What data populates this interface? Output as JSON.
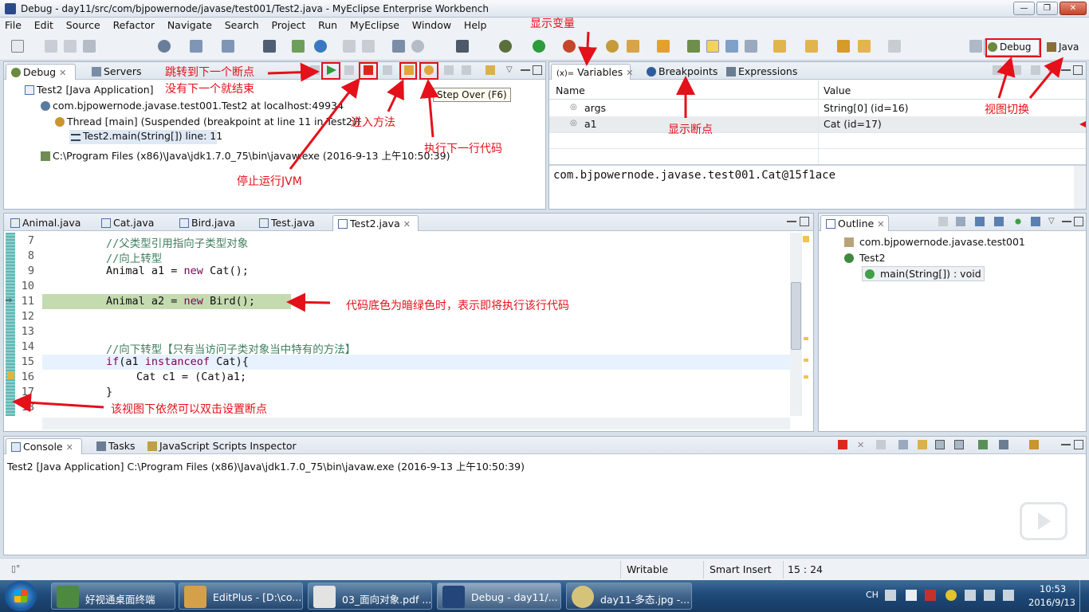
{
  "window": {
    "title": "Debug - day11/src/com/bjpowernode/javase/test001/Test2.java - MyEclipse Enterprise Workbench"
  },
  "menu": [
    "File",
    "Edit",
    "Source",
    "Refactor",
    "Navigate",
    "Search",
    "Project",
    "Run",
    "MyEclipse",
    "Window",
    "Help"
  ],
  "perspectives": {
    "debug": "Debug",
    "java": "Java"
  },
  "debug_view": {
    "tabs": {
      "debug": "Debug",
      "servers": "Servers"
    },
    "tooltip": "Step Over (F6)",
    "tree": [
      "Test2 [Java Application]",
      "com.bjpowernode.javase.test001.Test2 at localhost:49934",
      "Thread [main] (Suspended (breakpoint at line 11 in Test2))",
      "Test2.main(String[]) line: 11",
      "C:\\Program Files (x86)\\Java\\jdk1.7.0_75\\bin\\javaw.exe (2016-9-13 上午10:50:39)"
    ]
  },
  "variables_view": {
    "tabs": {
      "variables": "Variables",
      "breakpoints": "Breakpoints",
      "expressions": "Expressions"
    },
    "columns": {
      "name": "Name",
      "value": "Value"
    },
    "rows": [
      {
        "name": "args",
        "value": "String[0]  (id=16)"
      },
      {
        "name": "a1",
        "value": "Cat  (id=17)"
      }
    ],
    "detail": "com.bjpowernode.javase.test001.Cat@15f1ace"
  },
  "editor": {
    "tabs": [
      "Animal.java",
      "Cat.java",
      "Bird.java",
      "Test.java",
      "Test2.java"
    ],
    "active_tab": "Test2.java",
    "line_numbers": [
      "7",
      "8",
      "9",
      "10",
      "11",
      "12",
      "13",
      "14",
      "15",
      "16",
      "17",
      "18"
    ],
    "current_line": 11
  },
  "outline": {
    "tab": "Outline",
    "items": [
      "com.bjpowernode.javase.test001",
      "Test2",
      "main(String[]) : void"
    ]
  },
  "console": {
    "tabs": {
      "console": "Console",
      "tasks": "Tasks",
      "js": "JavaScript Scripts Inspector"
    },
    "text": "Test2 [Java Application] C:\\Program Files (x86)\\Java\\jdk1.7.0_75\\bin\\javaw.exe (2016-9-13 上午10:50:39)"
  },
  "statusbar": {
    "writable": "Writable",
    "insert": "Smart Insert",
    "position": "15 : 24"
  },
  "annotations": {
    "resume_1": "跳转到下一个断点",
    "resume_2": "没有下一个就结束",
    "step_into": "进入方法",
    "step_over": "执行下一行代码",
    "terminate": "停止运行JVM",
    "variables": "显示变量",
    "breakpoints": "显示断点",
    "perspective": "视图切换",
    "current_line": "代码底色为暗绿色时，表示即将执行该行代码",
    "ruler": "该视图下依然可以双击设置断点"
  },
  "taskbar": {
    "items": [
      "好视通桌面终端",
      "EditPlus - [D:\\co...",
      "03_面向对象.pdf ...",
      "Debug - day11/...",
      "day11-多态.jpg -..."
    ],
    "lang": "CH",
    "time": "10:53",
    "date": "2016/9/13"
  },
  "colors": {
    "annotation": "#e4101a",
    "current_line_bg": "#c4dbb0",
    "keyword": "#7f0055",
    "comment": "#3f7f5f"
  }
}
